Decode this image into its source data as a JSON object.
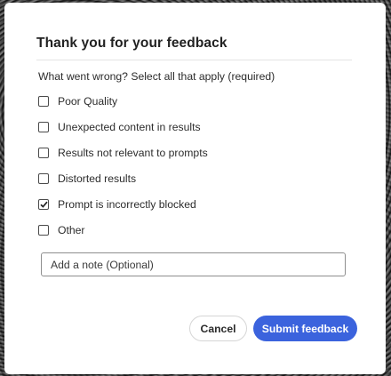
{
  "dialog": {
    "title": "Thank you for your feedback",
    "question": "What went wrong? Select all that apply (required)",
    "options": [
      {
        "label": "Poor Quality",
        "checked": false
      },
      {
        "label": "Unexpected content in results",
        "checked": false
      },
      {
        "label": "Results not relevant to prompts",
        "checked": false
      },
      {
        "label": "Distorted results",
        "checked": false
      },
      {
        "label": "Prompt is incorrectly blocked",
        "checked": true
      },
      {
        "label": "Other",
        "checked": false
      }
    ],
    "note": {
      "placeholder": "Add a note (Optional)",
      "value": ""
    },
    "cancel_label": "Cancel",
    "submit_label": "Submit feedback"
  },
  "colors": {
    "accent": "#3b63dd",
    "text": "#2c2c2c"
  },
  "icons": {
    "checkmark": "checkmark-icon"
  }
}
